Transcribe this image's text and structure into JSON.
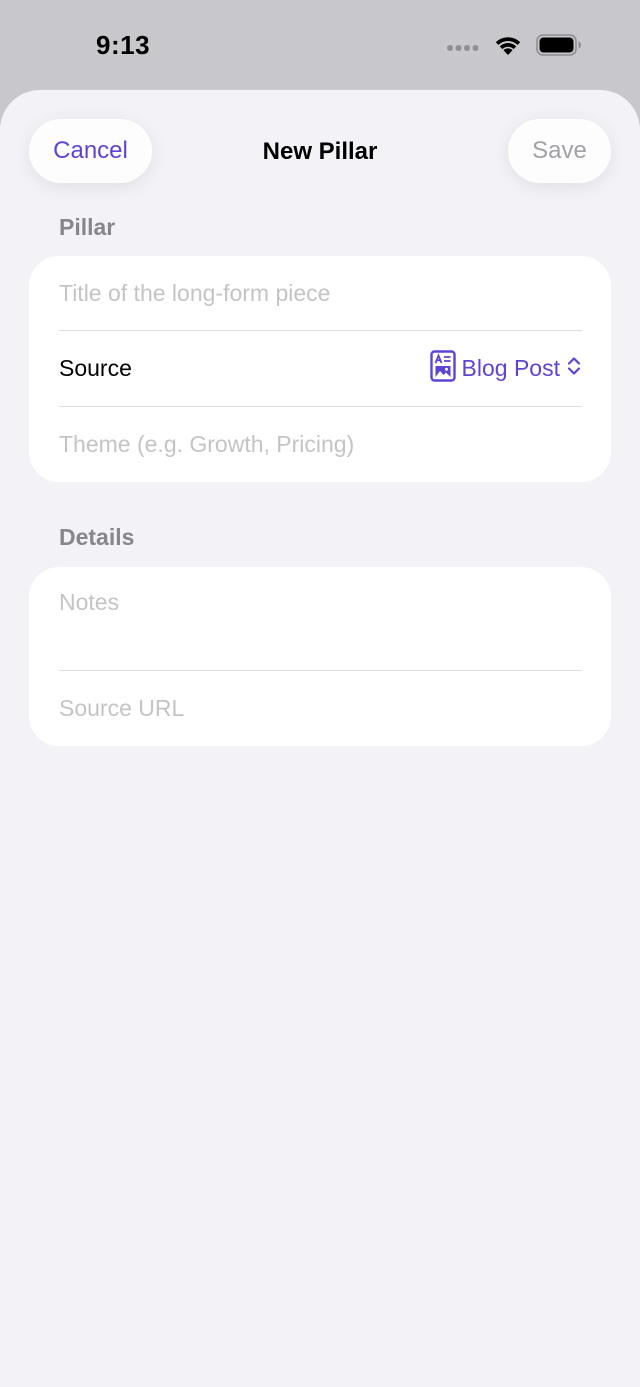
{
  "status_bar": {
    "time": "9:13",
    "icons": [
      "signal-dots-icon",
      "wifi-icon",
      "battery-icon"
    ]
  },
  "nav": {
    "cancel_label": "Cancel",
    "title": "New Pillar",
    "save_label": "Save"
  },
  "sections": {
    "pillar": {
      "header": "Pillar",
      "title_placeholder": "Title of the long-form piece",
      "source_label": "Source",
      "source_value": "Blog Post",
      "source_icon": "blog-post-icon",
      "theme_placeholder": "Theme (e.g. Growth, Pricing)"
    },
    "details": {
      "header": "Details",
      "notes_placeholder": "Notes",
      "source_url_placeholder": "Source URL"
    }
  },
  "colors": {
    "accent": "#5b45d6",
    "disabled": "#a1a1a6",
    "background": "#f2f2f7",
    "placeholder": "#c4c4c7",
    "section_header": "#86868b"
  }
}
